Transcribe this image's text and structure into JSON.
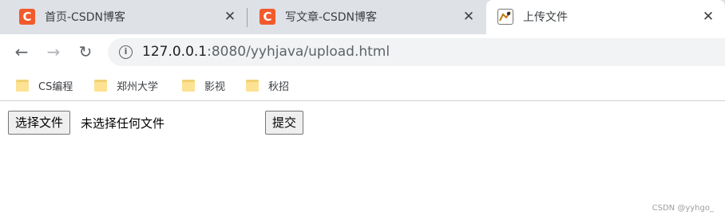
{
  "tabs": [
    {
      "title": "首页-CSDN博客",
      "favicon": "C",
      "close": "✕"
    },
    {
      "title": "写文章-CSDN博客",
      "favicon": "C",
      "close": "✕"
    },
    {
      "title": "上传文件",
      "close": "✕"
    }
  ],
  "toolbar": {
    "back_icon": "←",
    "forward_icon": "→",
    "reload_icon": "↻",
    "info_icon": "i",
    "url_host": "127.0.0.1",
    "url_rest": ":8080/yyhjava/upload.html"
  },
  "bookmarks": [
    "CS编程",
    "郑州大学",
    "影视",
    "秋招"
  ],
  "form": {
    "choose_file_label": "选择文件",
    "no_file_text": "未选择任何文件",
    "submit_label": "提交"
  },
  "watermark": "CSDN @yyhgo_",
  "colors": {
    "tabbar": "#dee1e6",
    "csdn_brand": "#f25a2c",
    "omnibox": "#f1f3f4"
  }
}
